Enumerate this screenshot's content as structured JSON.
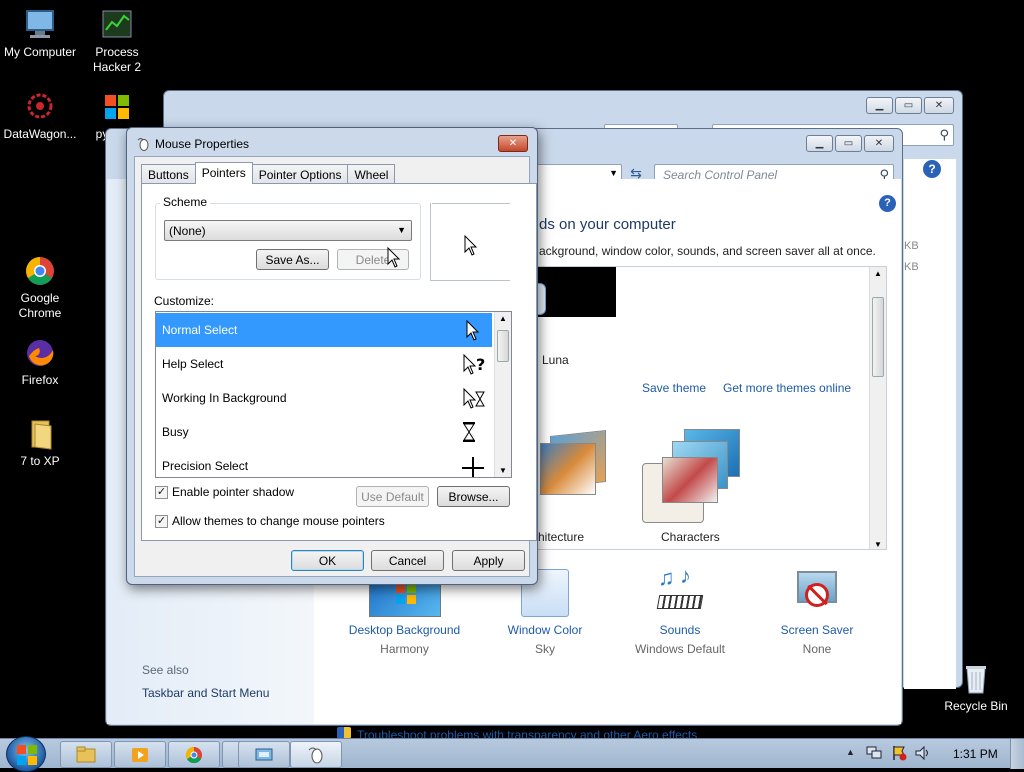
{
  "desktop": {
    "icons": [
      {
        "label": "My Computer",
        "icon": "computer-icon"
      },
      {
        "label": "Process Hacker 2",
        "icon": "process-hacker-icon"
      },
      {
        "label": "DataWagon...",
        "icon": "datawagon-icon"
      },
      {
        "label": "py",
        "icon": "windows-logo-icon"
      },
      {
        "label": "Google Chrome",
        "icon": "chrome-icon"
      },
      {
        "label": "Firefox",
        "icon": "firefox-icon"
      },
      {
        "label": "7 to XP",
        "icon": "folder-icon"
      },
      {
        "label": "Recycle Bin",
        "icon": "recycle-bin-icon"
      }
    ]
  },
  "personalization": {
    "search_placeholder": "Search Control Panel",
    "heading": "ds on your computer",
    "subheading": "ackground, window color, sounds, and screen saver all at once.",
    "theme_luna": "Luna",
    "save_theme": "Save theme",
    "get_more_themes": "Get more themes online",
    "theme_architecture": "hitecture",
    "theme_characters": "Characters",
    "see_also": "See also",
    "taskbar_link": "Taskbar and Start Menu",
    "bottom_items": [
      {
        "title": "Desktop Background",
        "value": "Harmony"
      },
      {
        "title": "Window Color",
        "value": "Sky"
      },
      {
        "title": "Sounds",
        "value": "Windows Default"
      },
      {
        "title": "Screen Saver",
        "value": "None"
      }
    ],
    "troubleshoot": "Troubleshoot problems with transparency and other Aero effects",
    "side_kb_1": "KB",
    "side_kb_2": "KB"
  },
  "dialog": {
    "title": "Mouse Properties",
    "tabs": [
      "Buttons",
      "Pointers",
      "Pointer Options",
      "Wheel"
    ],
    "active_tab": "Pointers",
    "scheme_label": "Scheme",
    "scheme_value": "(None)",
    "save_as": "Save As...",
    "delete": "Delete",
    "customize_label": "Customize:",
    "pointers": [
      {
        "label": "Normal Select",
        "icon": "arrow-cursor-icon"
      },
      {
        "label": "Help Select",
        "icon": "help-cursor-icon"
      },
      {
        "label": "Working In Background",
        "icon": "working-cursor-icon"
      },
      {
        "label": "Busy",
        "icon": "hourglass-cursor-icon"
      },
      {
        "label": "Precision Select",
        "icon": "crosshair-cursor-icon"
      }
    ],
    "enable_shadow": "Enable pointer shadow",
    "enable_shadow_checked": true,
    "allow_themes": "Allow themes to change mouse pointers",
    "allow_themes_checked": true,
    "use_default": "Use Default",
    "browse": "Browse...",
    "ok": "OK",
    "cancel": "Cancel",
    "apply": "Apply"
  },
  "taskbar": {
    "time": "1:31 PM"
  }
}
